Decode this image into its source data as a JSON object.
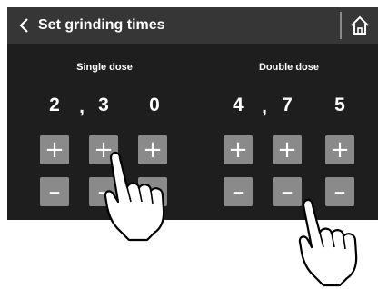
{
  "header": {
    "title": "Set grinding times",
    "back_icon": "chevron-left-icon",
    "home_icon": "home-icon"
  },
  "single_dose": {
    "label": "Single dose",
    "digits": [
      "2",
      "3",
      "0"
    ],
    "separator": ","
  },
  "double_dose": {
    "label": "Double dose",
    "digits": [
      "4",
      "7",
      "5"
    ],
    "separator": ","
  },
  "buttons": {
    "plus_label": "+",
    "minus_label": "–"
  },
  "colors": {
    "screen_background": "#1e1e1e",
    "header_background": "#363636",
    "button_background": "#8a8a8a",
    "text": "#ffffff"
  }
}
